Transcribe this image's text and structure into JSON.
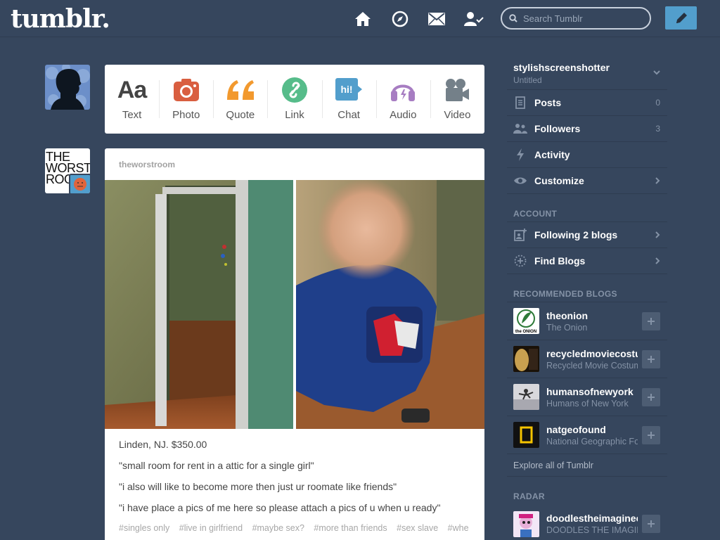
{
  "header": {
    "logo": "tumblr.",
    "search_placeholder": "Search Tumblr",
    "icons": [
      "home-icon",
      "explore-compass-icon",
      "inbox-mail-icon",
      "account-user-icon",
      "compose-pencil-icon"
    ]
  },
  "post_types": [
    {
      "label": "Text",
      "icon": "text-icon",
      "color": "#444444"
    },
    {
      "label": "Photo",
      "icon": "camera-icon",
      "color": "#d95e40"
    },
    {
      "label": "Quote",
      "icon": "quote-icon",
      "color": "#f2992e"
    },
    {
      "label": "Link",
      "icon": "link-icon",
      "color": "#56bc8a"
    },
    {
      "label": "Chat",
      "icon": "chat-icon",
      "color": "#529ecc"
    },
    {
      "label": "Audio",
      "icon": "headphones-icon",
      "color": "#a77dc2"
    },
    {
      "label": "Video",
      "icon": "video-camera-icon",
      "color": "#748089"
    }
  ],
  "blog_avatar_text": "THE WORST ROO",
  "post": {
    "author": "theworstroom",
    "lines": [
      "Linden, NJ. $350.00",
      "\"small room for rent in a attic for a single girl\"",
      "\"i also will like to become more then just ur roomate like friends\"",
      "\"i have place a pics of me here so please attach a pics of u when u ready\""
    ],
    "tags": [
      "#singles only",
      "#live in girlfriend",
      "#maybe sex?",
      "#more than friends",
      "#sex slave",
      "#whe"
    ]
  },
  "sidebar": {
    "blog_name": "stylishscreenshotter",
    "blog_title": "Untitled",
    "items": [
      {
        "label": "Posts",
        "count": "0",
        "icon": "posts-icon"
      },
      {
        "label": "Followers",
        "count": "3",
        "icon": "followers-icon"
      },
      {
        "label": "Activity",
        "count": "",
        "icon": "activity-bolt-icon"
      },
      {
        "label": "Customize",
        "count": "",
        "icon": "customize-eye-icon"
      }
    ],
    "account_header": "ACCOUNT",
    "account_items": [
      {
        "label": "Following 2 blogs",
        "icon": "following-icon"
      },
      {
        "label": "Find Blogs",
        "icon": "find-blogs-icon"
      }
    ],
    "recommended_header": "RECOMMENDED BLOGS",
    "recommended": [
      {
        "name": "theonion",
        "title": "The Onion"
      },
      {
        "name": "recycledmoviecostumes",
        "title": "Recycled Movie Costumes"
      },
      {
        "name": "humansofnewyork",
        "title": "Humans of New York"
      },
      {
        "name": "natgeofound",
        "title": "National Geographic Found"
      }
    ],
    "explore_link": "Explore all of Tumblr",
    "radar_header": "RADAR",
    "radar": {
      "name": "doodlestheimagineer",
      "title": "DOODLES THE IMAGINEER"
    }
  },
  "colors": {
    "background": "#36465d",
    "accent": "#529ecc"
  }
}
